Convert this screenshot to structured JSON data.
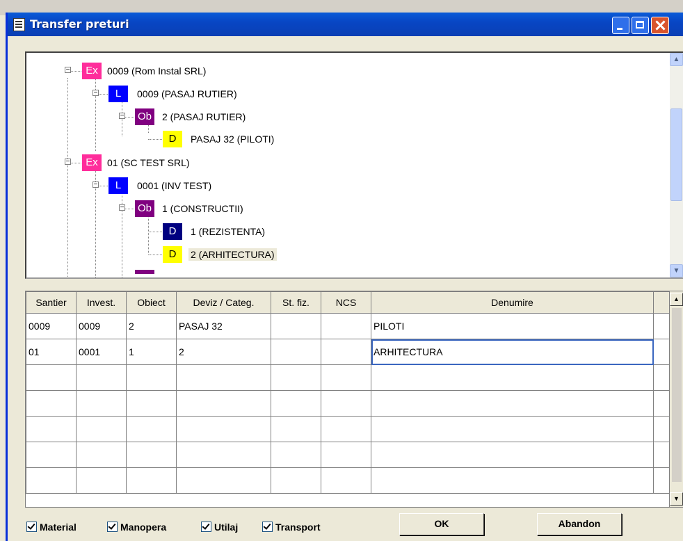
{
  "window": {
    "title": "Transfer preturi"
  },
  "tree": {
    "nodes": [
      {
        "badge": "Ex",
        "label": "0009 (Rom Instal SRL)"
      },
      {
        "badge": "L",
        "label": "0009 (PASAJ RUTIER)"
      },
      {
        "badge": "Ob",
        "label": "2 (PASAJ RUTIER)"
      },
      {
        "badge": "D",
        "label": "PASAJ 32 (PILOTI)"
      },
      {
        "badge": "Ex",
        "label": "01 (SC TEST SRL)"
      },
      {
        "badge": "L",
        "label": "0001 (INV TEST)"
      },
      {
        "badge": "Ob",
        "label": "1 (CONSTRUCTII)"
      },
      {
        "badge": "D",
        "label": "1 (REZISTENTA)"
      },
      {
        "badge": "D",
        "label": "2 (ARHITECTURA)"
      }
    ]
  },
  "grid": {
    "columns": [
      "Santier",
      "Invest.",
      "Obiect",
      "Deviz / Categ.",
      "St. fiz.",
      "NCS",
      "Denumire"
    ],
    "rows": [
      [
        "0009",
        "0009",
        "2",
        "PASAJ 32",
        "",
        "",
        "PILOTI"
      ],
      [
        "01",
        "0001",
        "1",
        "2",
        "",
        "",
        "ARHITECTURA"
      ],
      [
        "",
        "",
        "",
        "",
        "",
        "",
        ""
      ],
      [
        "",
        "",
        "",
        "",
        "",
        "",
        ""
      ],
      [
        "",
        "",
        "",
        "",
        "",
        "",
        ""
      ],
      [
        "",
        "",
        "",
        "",
        "",
        "",
        ""
      ],
      [
        "",
        "",
        "",
        "",
        "",
        "",
        ""
      ]
    ]
  },
  "options": {
    "material": "Material",
    "manopera": "Manopera",
    "utilaj": "Utilaj",
    "transport": "Transport"
  },
  "buttons": {
    "ok": "OK",
    "abandon": "Abandon"
  }
}
